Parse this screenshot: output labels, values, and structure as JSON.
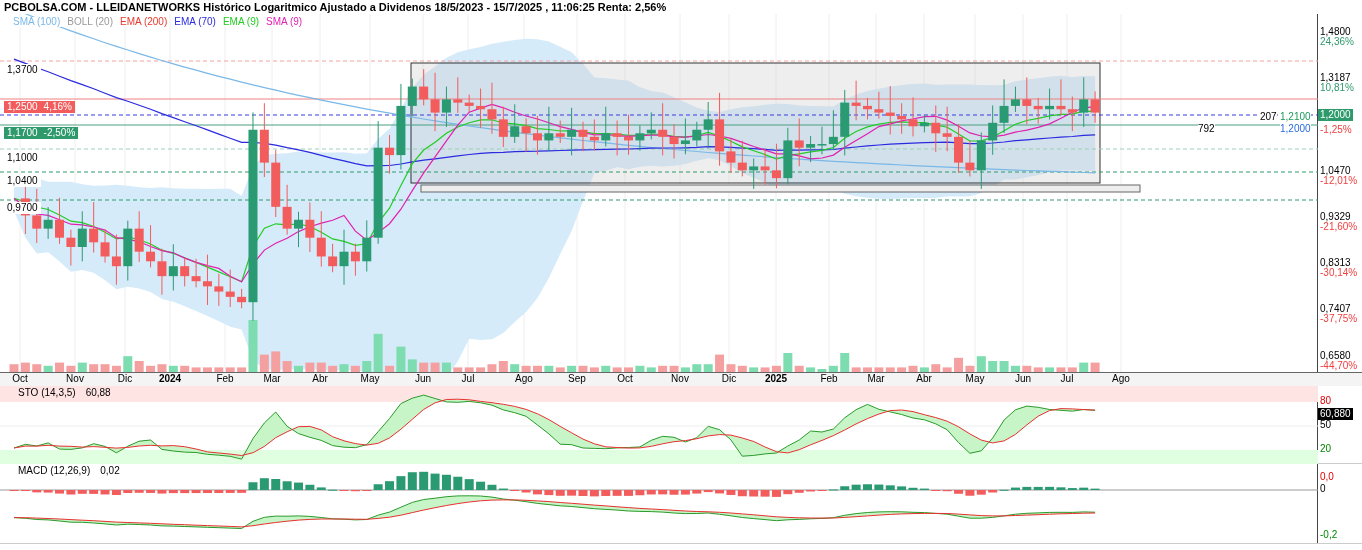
{
  "title": "PCBOLSA.COM - LLEIDANETWORKS Histórico Logaritmico Ajustado a Dividenos 18/5/2023 - 15/7/2025 , 11:06:25 Renta: 2,56%",
  "legend": [
    {
      "label": "SMA (100)",
      "color": "#7ab8e8"
    },
    {
      "label": "BOLL (20)",
      "color": "#9a9a9a"
    },
    {
      "label": "EMA (200)",
      "color": "#e8392c"
    },
    {
      "label": "EMA (70)",
      "color": "#2a2ae0"
    },
    {
      "label": "EMA (9)",
      "color": "#22cc22"
    },
    {
      "label": "SMA (9)",
      "color": "#e020b0"
    }
  ],
  "price_labels": [
    {
      "price": "1,3700",
      "kind": "plain"
    },
    {
      "price": "1,2500",
      "change": "4,16%",
      "kind": "resistance"
    },
    {
      "price": "1,1700",
      "change": "-2,50%",
      "kind": "support"
    },
    {
      "price": "1,1000",
      "kind": "plain"
    },
    {
      "price": "1,0400",
      "kind": "plain"
    },
    {
      "price": "0,9700",
      "kind": "plain"
    }
  ],
  "line_labels": [
    {
      "text": "207",
      "kind": "count"
    },
    {
      "text": "1,2100",
      "kind": "high"
    },
    {
      "text": "792",
      "kind": "count"
    },
    {
      "text": "1,2000",
      "kind": "close"
    }
  ],
  "price_axis": {
    "ticks": [
      {
        "price": "1,4800",
        "change": "24,36%",
        "kind": "up"
      },
      {
        "price": "1,3187",
        "change": "10,81%",
        "kind": "up"
      },
      {
        "price": "1,0470",
        "change": "-12,01%",
        "kind": "down"
      },
      {
        "price": "0,9329",
        "change": "-21,60%",
        "kind": "down"
      },
      {
        "price": "0,8313",
        "change": "-30,14%",
        "kind": "down"
      },
      {
        "price": "0,7407",
        "change": "-37,75%",
        "kind": "down"
      },
      {
        "price": "0,6580",
        "change": "-44,70%",
        "kind": "down"
      }
    ],
    "current": {
      "price": "1,2000",
      "change": "-1,25%"
    }
  },
  "x_axis": [
    {
      "label": "Oct",
      "kind": "month"
    },
    {
      "label": "Nov",
      "kind": "month"
    },
    {
      "label": "Dic",
      "kind": "month"
    },
    {
      "label": "2024",
      "kind": "year"
    },
    {
      "label": "Feb",
      "kind": "month"
    },
    {
      "label": "Mar",
      "kind": "month"
    },
    {
      "label": "Abr",
      "kind": "month"
    },
    {
      "label": "May",
      "kind": "month"
    },
    {
      "label": "Jun",
      "kind": "month"
    },
    {
      "label": "Jul",
      "kind": "month"
    },
    {
      "label": "Ago",
      "kind": "month"
    },
    {
      "label": "Sep",
      "kind": "month"
    },
    {
      "label": "Oct",
      "kind": "month"
    },
    {
      "label": "Nov",
      "kind": "month"
    },
    {
      "label": "Dic",
      "kind": "month"
    },
    {
      "label": "2025",
      "kind": "year"
    },
    {
      "label": "Feb",
      "kind": "month"
    },
    {
      "label": "Mar",
      "kind": "month"
    },
    {
      "label": "Abr",
      "kind": "month"
    },
    {
      "label": "May",
      "kind": "month"
    },
    {
      "label": "Jun",
      "kind": "month"
    },
    {
      "label": "Jul",
      "kind": "month"
    },
    {
      "label": "Ago",
      "kind": "month"
    }
  ],
  "sto": {
    "label": "STO (14,3,5)",
    "value": "60,88",
    "badge": "60,880",
    "ticks": [
      {
        "text": "80",
        "kind": "upper"
      },
      {
        "text": "50",
        "kind": "middle"
      },
      {
        "text": "20",
        "kind": "lower"
      }
    ]
  },
  "macd": {
    "label": "MACD (12,26,9)",
    "value": "0,02",
    "ticks": [
      {
        "text": "0,0",
        "kind": "upper"
      },
      {
        "text": "0",
        "kind": "zero"
      },
      {
        "text": "-0,2",
        "kind": "lower"
      }
    ]
  }
}
